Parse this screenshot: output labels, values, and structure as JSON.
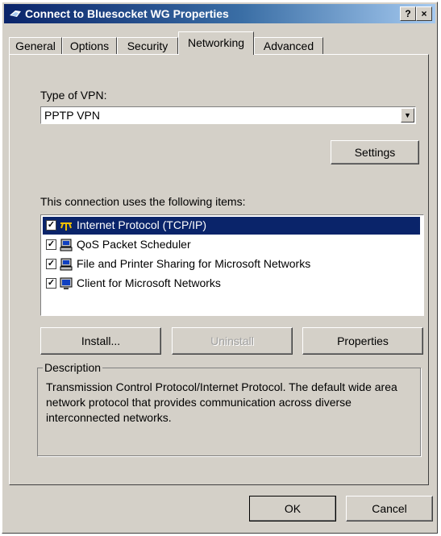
{
  "window": {
    "title": "Connect to Bluesocket WG Properties",
    "help_glyph": "?",
    "close_glyph": "×"
  },
  "tabs": [
    {
      "label": "General",
      "active": false
    },
    {
      "label": "Options",
      "active": false
    },
    {
      "label": "Security",
      "active": false
    },
    {
      "label": "Networking",
      "active": true
    },
    {
      "label": "Advanced",
      "active": false
    }
  ],
  "vpn": {
    "label": "Type of VPN:",
    "value": "PPTP VPN",
    "settings_label": "Settings"
  },
  "items": {
    "label": "This connection uses the following items:",
    "list": [
      {
        "label": "Internet Protocol (TCP/IP)",
        "checked": true,
        "selected": true,
        "icon": "protocol-icon"
      },
      {
        "label": "QoS Packet Scheduler",
        "checked": true,
        "selected": false,
        "icon": "network-service-icon"
      },
      {
        "label": "File and Printer Sharing for Microsoft Networks",
        "checked": true,
        "selected": false,
        "icon": "network-service-icon"
      },
      {
        "label": "Client for Microsoft Networks",
        "checked": true,
        "selected": false,
        "icon": "network-client-icon"
      }
    ]
  },
  "buttons": {
    "install": "Install...",
    "uninstall": "Uninstall",
    "properties": "Properties",
    "ok": "OK",
    "cancel": "Cancel"
  },
  "description": {
    "label": "Description",
    "text": "Transmission Control Protocol/Internet Protocol. The default wide area network protocol that provides communication across diverse interconnected networks."
  },
  "colors": {
    "selection": "#0a246a",
    "face": "#d4d0c8",
    "titlebar_start": "#0a246a",
    "titlebar_end": "#a6caf0"
  }
}
